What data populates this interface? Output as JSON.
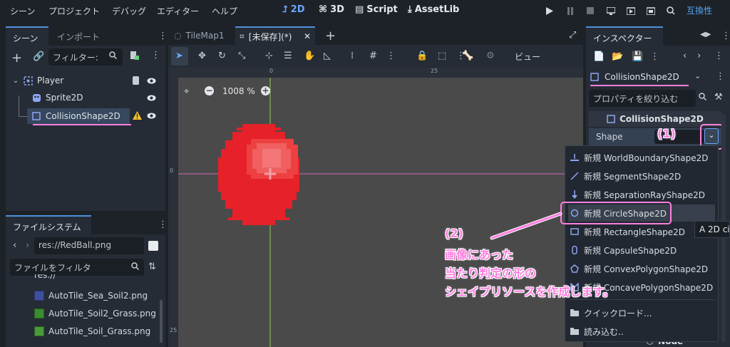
{
  "menu": [
    "シーン",
    "プロジェクト",
    "デバッグ",
    "エディター",
    "ヘルプ"
  ],
  "workspaces": [
    {
      "label": "2D",
      "icon": "2d-icon"
    },
    {
      "label": "3D",
      "icon": "3d-icon"
    },
    {
      "label": "Script",
      "icon": "script-icon"
    },
    {
      "label": "AssetLib",
      "icon": "assetlib-icon"
    }
  ],
  "renderer_label": "互換性",
  "scene_dock": {
    "tabs": [
      "シーン",
      "インポート"
    ],
    "filter_placeholder": "フィルター:",
    "nodes": [
      {
        "name": "Player",
        "icon": "node2d-icon"
      },
      {
        "name": "Sprite2D",
        "icon": "sprite2d-icon"
      },
      {
        "name": "CollisionShape2D",
        "icon": "collisionshape-icon"
      }
    ]
  },
  "filesystem_dock": {
    "tab": "ファイルシステム",
    "path": "res://RedBall.png",
    "filter_placeholder": "ファイルをフィルタ",
    "root_label": "res://",
    "files": [
      "AutoTile_Sea_Soil2.png",
      "AutoTile_Soil2_Grass.png",
      "AutoTile_Soil_Grass.png"
    ]
  },
  "editor_tabs": [
    {
      "label": "TileMap1"
    },
    {
      "label": "[未保存](*)"
    }
  ],
  "viewport": {
    "zoom": "1008 %",
    "view_menu": "ビュー",
    "ruler_marks": [
      "0",
      "25"
    ],
    "vruler_marks": [
      "0",
      "25"
    ]
  },
  "inspector": {
    "tab": "インスペクター",
    "selected_node": "CollisionShape2D",
    "filter_placeholder": "プロパティを絞り込む",
    "section_title": "CollisionShape2D",
    "property_name": "Shape",
    "bottom_section": "Node"
  },
  "dropdown": {
    "items": [
      {
        "label": "新規 WorldBoundaryShape2D",
        "icon": "world-boundary-icon"
      },
      {
        "label": "新規 SegmentShape2D",
        "icon": "segment-icon"
      },
      {
        "label": "新規 SeparationRayShape2D",
        "icon": "separation-ray-icon"
      },
      {
        "label": "新規 CircleShape2D",
        "icon": "circle-shape-icon"
      },
      {
        "label": "新規 RectangleShape2D",
        "icon": "rectangle-shape-icon"
      },
      {
        "label": "新規 CapsuleShape2D",
        "icon": "capsule-shape-icon"
      },
      {
        "label": "新規 ConvexPolygonShape2D",
        "icon": "convex-polygon-icon"
      },
      {
        "label": "新規 ConcavePolygonShape2D",
        "icon": "concave-polygon-icon"
      },
      {
        "label": "クイックロード...",
        "icon": "quick-load-icon"
      },
      {
        "label": "読み込む..",
        "icon": "load-icon"
      }
    ]
  },
  "tooltip": "A 2D cir",
  "annotations": {
    "step1": "(1)",
    "step2": "(2)",
    "step2_text": [
      "画像にあった",
      "当たり判定の形の",
      "シェイプリソースを作成します。"
    ]
  },
  "colors": {
    "accent": "#4f8fdc",
    "annotation": "#ff7fe0",
    "ball": "#e62129",
    "warning": "#f0c030"
  }
}
